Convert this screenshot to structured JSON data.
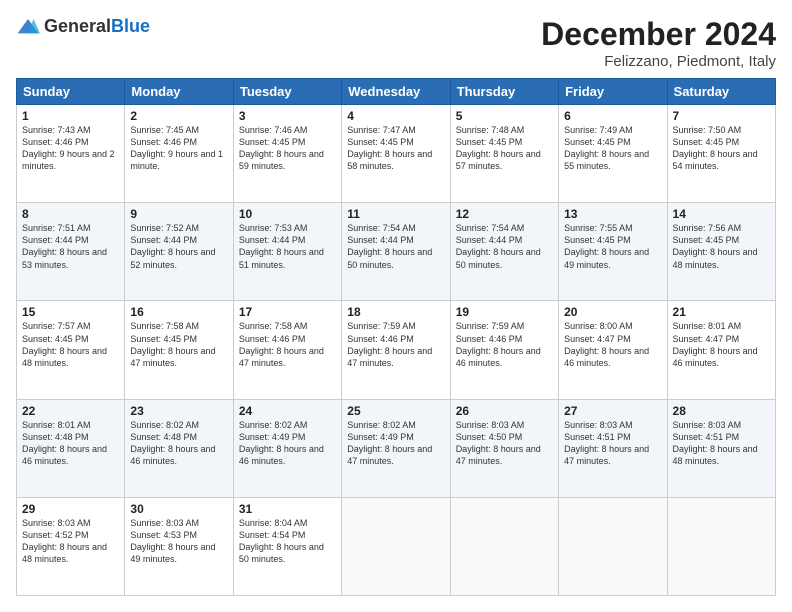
{
  "logo": {
    "general": "General",
    "blue": "Blue"
  },
  "header": {
    "title": "December 2024",
    "subtitle": "Felizzano, Piedmont, Italy"
  },
  "weekdays": [
    "Sunday",
    "Monday",
    "Tuesday",
    "Wednesday",
    "Thursday",
    "Friday",
    "Saturday"
  ],
  "weeks": [
    [
      {
        "day": "1",
        "sunrise": "Sunrise: 7:43 AM",
        "sunset": "Sunset: 4:46 PM",
        "daylight": "Daylight: 9 hours and 2 minutes."
      },
      {
        "day": "2",
        "sunrise": "Sunrise: 7:45 AM",
        "sunset": "Sunset: 4:46 PM",
        "daylight": "Daylight: 9 hours and 1 minute."
      },
      {
        "day": "3",
        "sunrise": "Sunrise: 7:46 AM",
        "sunset": "Sunset: 4:45 PM",
        "daylight": "Daylight: 8 hours and 59 minutes."
      },
      {
        "day": "4",
        "sunrise": "Sunrise: 7:47 AM",
        "sunset": "Sunset: 4:45 PM",
        "daylight": "Daylight: 8 hours and 58 minutes."
      },
      {
        "day": "5",
        "sunrise": "Sunrise: 7:48 AM",
        "sunset": "Sunset: 4:45 PM",
        "daylight": "Daylight: 8 hours and 57 minutes."
      },
      {
        "day": "6",
        "sunrise": "Sunrise: 7:49 AM",
        "sunset": "Sunset: 4:45 PM",
        "daylight": "Daylight: 8 hours and 55 minutes."
      },
      {
        "day": "7",
        "sunrise": "Sunrise: 7:50 AM",
        "sunset": "Sunset: 4:45 PM",
        "daylight": "Daylight: 8 hours and 54 minutes."
      }
    ],
    [
      {
        "day": "8",
        "sunrise": "Sunrise: 7:51 AM",
        "sunset": "Sunset: 4:44 PM",
        "daylight": "Daylight: 8 hours and 53 minutes."
      },
      {
        "day": "9",
        "sunrise": "Sunrise: 7:52 AM",
        "sunset": "Sunset: 4:44 PM",
        "daylight": "Daylight: 8 hours and 52 minutes."
      },
      {
        "day": "10",
        "sunrise": "Sunrise: 7:53 AM",
        "sunset": "Sunset: 4:44 PM",
        "daylight": "Daylight: 8 hours and 51 minutes."
      },
      {
        "day": "11",
        "sunrise": "Sunrise: 7:54 AM",
        "sunset": "Sunset: 4:44 PM",
        "daylight": "Daylight: 8 hours and 50 minutes."
      },
      {
        "day": "12",
        "sunrise": "Sunrise: 7:54 AM",
        "sunset": "Sunset: 4:44 PM",
        "daylight": "Daylight: 8 hours and 50 minutes."
      },
      {
        "day": "13",
        "sunrise": "Sunrise: 7:55 AM",
        "sunset": "Sunset: 4:45 PM",
        "daylight": "Daylight: 8 hours and 49 minutes."
      },
      {
        "day": "14",
        "sunrise": "Sunrise: 7:56 AM",
        "sunset": "Sunset: 4:45 PM",
        "daylight": "Daylight: 8 hours and 48 minutes."
      }
    ],
    [
      {
        "day": "15",
        "sunrise": "Sunrise: 7:57 AM",
        "sunset": "Sunset: 4:45 PM",
        "daylight": "Daylight: 8 hours and 48 minutes."
      },
      {
        "day": "16",
        "sunrise": "Sunrise: 7:58 AM",
        "sunset": "Sunset: 4:45 PM",
        "daylight": "Daylight: 8 hours and 47 minutes."
      },
      {
        "day": "17",
        "sunrise": "Sunrise: 7:58 AM",
        "sunset": "Sunset: 4:46 PM",
        "daylight": "Daylight: 8 hours and 47 minutes."
      },
      {
        "day": "18",
        "sunrise": "Sunrise: 7:59 AM",
        "sunset": "Sunset: 4:46 PM",
        "daylight": "Daylight: 8 hours and 47 minutes."
      },
      {
        "day": "19",
        "sunrise": "Sunrise: 7:59 AM",
        "sunset": "Sunset: 4:46 PM",
        "daylight": "Daylight: 8 hours and 46 minutes."
      },
      {
        "day": "20",
        "sunrise": "Sunrise: 8:00 AM",
        "sunset": "Sunset: 4:47 PM",
        "daylight": "Daylight: 8 hours and 46 minutes."
      },
      {
        "day": "21",
        "sunrise": "Sunrise: 8:01 AM",
        "sunset": "Sunset: 4:47 PM",
        "daylight": "Daylight: 8 hours and 46 minutes."
      }
    ],
    [
      {
        "day": "22",
        "sunrise": "Sunrise: 8:01 AM",
        "sunset": "Sunset: 4:48 PM",
        "daylight": "Daylight: 8 hours and 46 minutes."
      },
      {
        "day": "23",
        "sunrise": "Sunrise: 8:02 AM",
        "sunset": "Sunset: 4:48 PM",
        "daylight": "Daylight: 8 hours and 46 minutes."
      },
      {
        "day": "24",
        "sunrise": "Sunrise: 8:02 AM",
        "sunset": "Sunset: 4:49 PM",
        "daylight": "Daylight: 8 hours and 46 minutes."
      },
      {
        "day": "25",
        "sunrise": "Sunrise: 8:02 AM",
        "sunset": "Sunset: 4:49 PM",
        "daylight": "Daylight: 8 hours and 47 minutes."
      },
      {
        "day": "26",
        "sunrise": "Sunrise: 8:03 AM",
        "sunset": "Sunset: 4:50 PM",
        "daylight": "Daylight: 8 hours and 47 minutes."
      },
      {
        "day": "27",
        "sunrise": "Sunrise: 8:03 AM",
        "sunset": "Sunset: 4:51 PM",
        "daylight": "Daylight: 8 hours and 47 minutes."
      },
      {
        "day": "28",
        "sunrise": "Sunrise: 8:03 AM",
        "sunset": "Sunset: 4:51 PM",
        "daylight": "Daylight: 8 hours and 48 minutes."
      }
    ],
    [
      {
        "day": "29",
        "sunrise": "Sunrise: 8:03 AM",
        "sunset": "Sunset: 4:52 PM",
        "daylight": "Daylight: 8 hours and 48 minutes."
      },
      {
        "day": "30",
        "sunrise": "Sunrise: 8:03 AM",
        "sunset": "Sunset: 4:53 PM",
        "daylight": "Daylight: 8 hours and 49 minutes."
      },
      {
        "day": "31",
        "sunrise": "Sunrise: 8:04 AM",
        "sunset": "Sunset: 4:54 PM",
        "daylight": "Daylight: 8 hours and 50 minutes."
      },
      null,
      null,
      null,
      null
    ]
  ]
}
